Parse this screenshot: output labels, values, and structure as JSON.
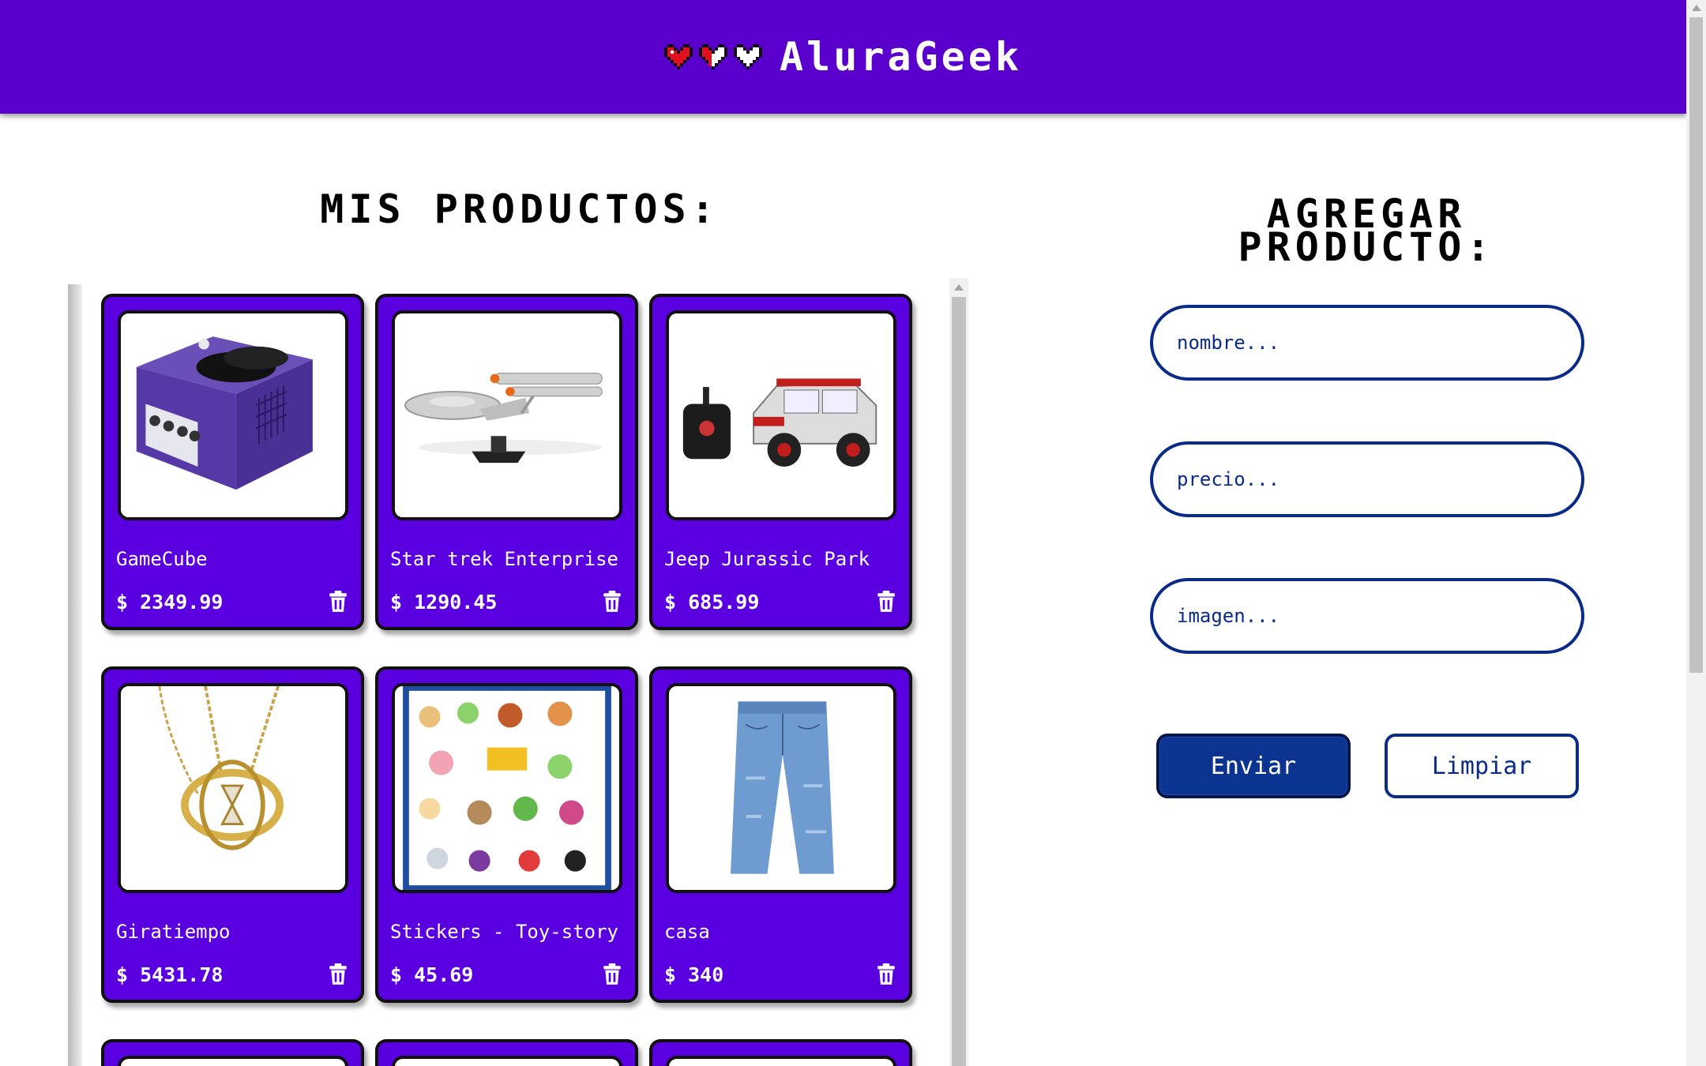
{
  "header": {
    "brand": "AluraGeek",
    "colors": {
      "bar": "#5a00cc",
      "heart_red": "#e01020",
      "heart_white": "#ffffff"
    },
    "icons": [
      "heart-full-icon",
      "heart-half-icon",
      "heart-empty-icon"
    ]
  },
  "products_section": {
    "title": "MIS PRODUCTOS:",
    "items": [
      {
        "name": "GameCube",
        "price": "$ 2349.99",
        "image": "gamecube-console"
      },
      {
        "name": "Star trek Enterprise",
        "price": "$ 1290.45",
        "image": "starship-model"
      },
      {
        "name": "Jeep Jurassic Park",
        "price": "$ 685.99",
        "image": "rc-jeep-toy"
      },
      {
        "name": "Giratiempo",
        "price": "$ 5431.78",
        "image": "time-turner-necklace"
      },
      {
        "name": "Stickers - Toy-story",
        "price": "$ 45.69",
        "image": "toy-story-stickers"
      },
      {
        "name": "casa",
        "price": "$ 340",
        "image": "jeans"
      }
    ],
    "delete_icon": "trash-icon",
    "card_color": "#5a00e0"
  },
  "form": {
    "title": "AGREGAR\nPRODUCTO:",
    "name_placeholder": "nombre...",
    "price_placeholder": "precio...",
    "image_placeholder": "imagen...",
    "send_label": "Enviar",
    "clear_label": "Limpiar",
    "accent": "#0a2a88"
  }
}
